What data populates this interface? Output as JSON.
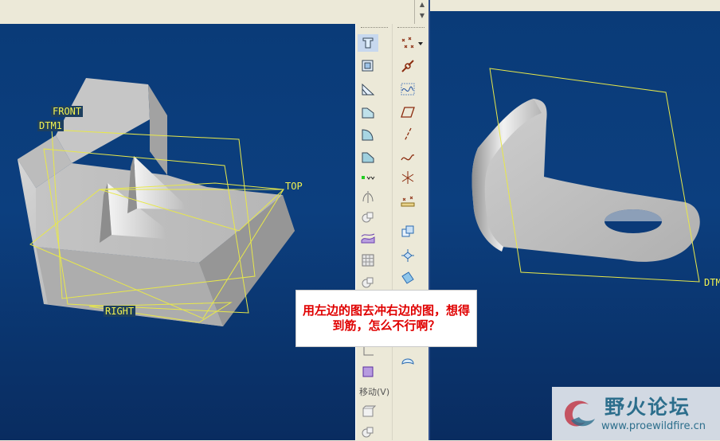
{
  "annotation": {
    "text": "用左边的图去冲右边的图，想得到筋，怎么不行啊？"
  },
  "left_view": {
    "datums": {
      "front": "FRONT",
      "dtm1": "DTM1",
      "top": "TOP",
      "right": "RIGHT"
    }
  },
  "right_view": {
    "datum": "DTM"
  },
  "toolbar": {
    "move_label": "移动(V)",
    "left_icons": [
      "draft-icon",
      "shell-icon",
      "rib-icon",
      "round-icon",
      "chamfer-icon",
      "round-set-icon",
      "ref-points-icon",
      "mirror-icon",
      "pattern-icon",
      "surface-icon",
      "grid-icon",
      "revolve-icon",
      "empty",
      "plane-icon",
      "merge-icon",
      "shell2-icon",
      "pattern2-icon"
    ],
    "right_icons": [
      "datum-point-icon",
      "chain-icon",
      "datum-curve-icon",
      "sketch-plane-icon",
      "axis-icon",
      "curve-icon",
      "coordinate-system-icon",
      "analysis-icon",
      "copy-icon",
      "transform-icon",
      "offset-icon",
      "note-icon"
    ]
  },
  "watermark": {
    "title": "野火论坛",
    "url": "www.proewildfire.cn"
  },
  "colors": {
    "viewport_bg": "#0a3b78",
    "datum_yellow": "#f2f250",
    "annotation_red": "#e00000",
    "part_gray": "#c9c9c9"
  }
}
